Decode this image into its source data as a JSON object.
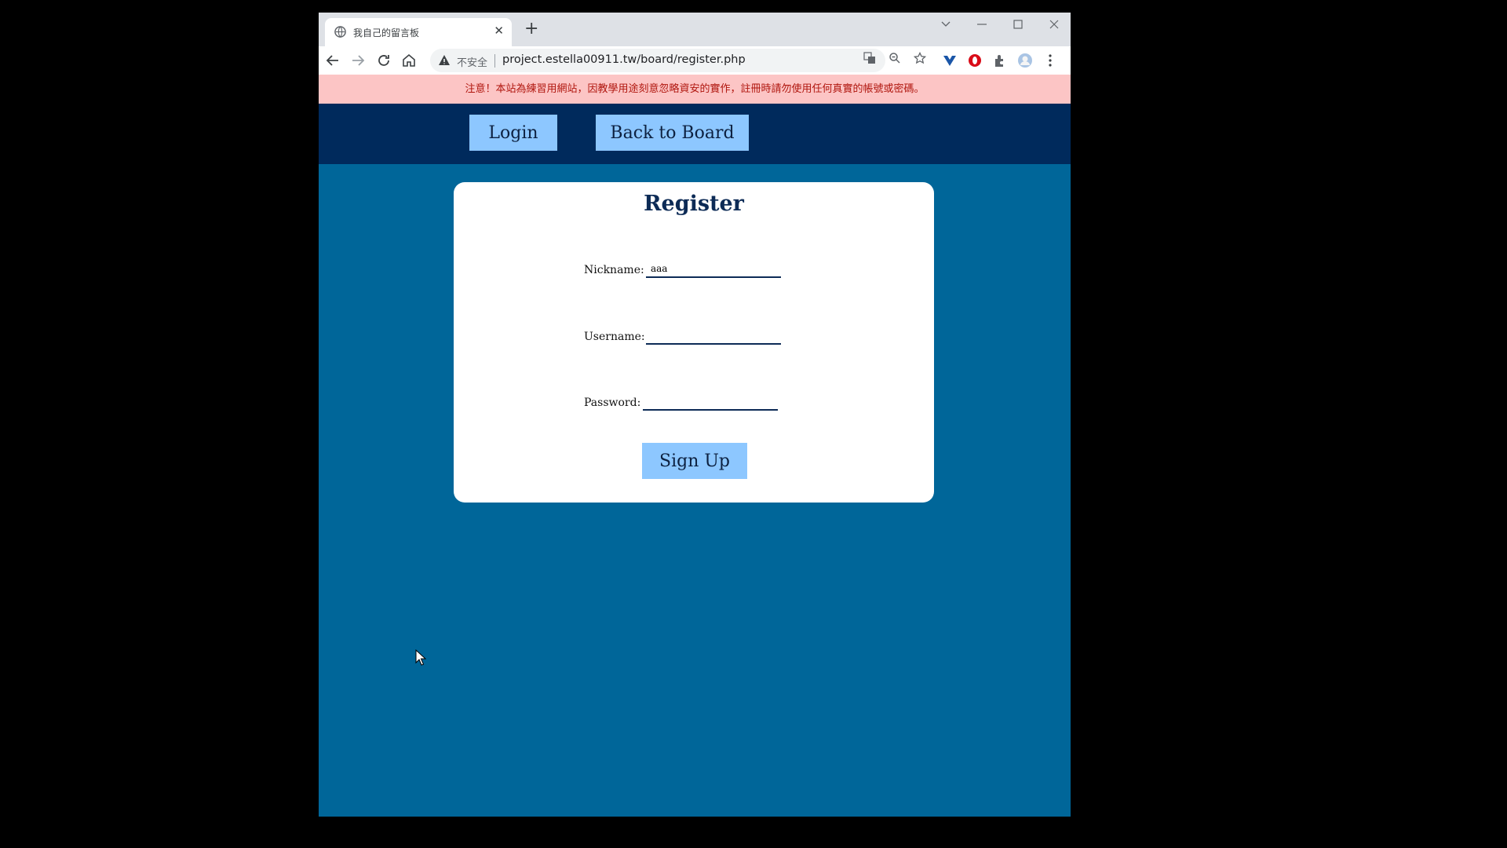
{
  "browser": {
    "tab_title": "我自己的留言板",
    "tab_close": "✕",
    "new_tab": "+",
    "security_label": "不安全",
    "url": "project.estella00911.tw/board/register.php"
  },
  "page": {
    "notice": "注意！本站為練習用網站，因教學用途刻意忽略資安的實作，註冊時請勿使用任何真實的帳號或密碼。",
    "nav": {
      "login_label": "Login",
      "back_label": "Back to Board"
    },
    "form": {
      "title": "Register",
      "nickname_label": "Nickname:",
      "nickname_value": "aaa",
      "username_label": "Username:",
      "username_value": "",
      "password_label": "Password:",
      "password_value": "",
      "submit_label": "Sign Up"
    }
  },
  "colors": {
    "page_bg": "#006699",
    "navbar_bg": "#002a5c",
    "button_bg": "#8dc7ff",
    "notice_bg": "#fcc5c5",
    "notice_text": "#b0160e"
  }
}
